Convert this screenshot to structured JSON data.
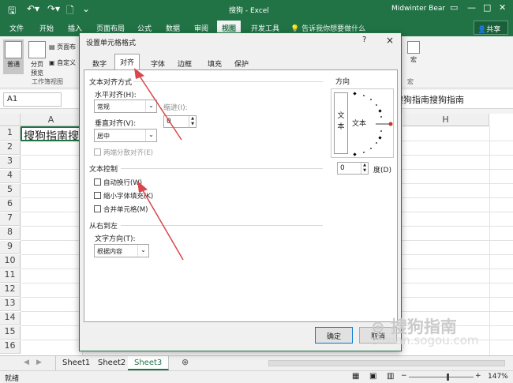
{
  "window": {
    "title": "搜狗 - Excel",
    "user": "Midwinter Bear"
  },
  "ribbon_tabs": [
    "文件",
    "开始",
    "插入",
    "页面布局",
    "公式",
    "数据",
    "审阅",
    "视图",
    "开发工具"
  ],
  "active_tab": "视图",
  "tell_me": "告诉我你想要做什么",
  "share": "共享",
  "ribbon": {
    "normal": "普通",
    "page_break_l1": "分页",
    "page_break_l2": "预览",
    "page_layout": "页面布",
    "custom_view": "自定义",
    "group_label": "工作簿视图",
    "macro": "宏",
    "macro_group": "宏"
  },
  "formula_bar": {
    "name_box": "A1",
    "content": "搜狗指南搜狗指南"
  },
  "grid": {
    "columns": [
      "A",
      "H"
    ],
    "rows": [
      "1",
      "2",
      "3",
      "4",
      "5",
      "6",
      "7",
      "8",
      "9",
      "10",
      "11",
      "12",
      "13",
      "14",
      "15",
      "16"
    ],
    "cell_a1": "搜狗指南搜"
  },
  "sheets": [
    "Sheet1",
    "Sheet2",
    "Sheet3"
  ],
  "active_sheet": "Sheet3",
  "status": {
    "mode": "就绪",
    "zoom": "147%"
  },
  "dialog": {
    "title": "设置单元格格式",
    "help": "?",
    "close": "×",
    "tabs": [
      "数字",
      "对齐",
      "字体",
      "边框",
      "填充",
      "保护"
    ],
    "active_tab": "对齐",
    "text_align_title": "文本对齐方式",
    "h_align_label": "水平对齐(H):",
    "h_align_value": "常规",
    "indent_label": "缩进(I):",
    "indent_value": "0",
    "v_align_label": "垂直对齐(V):",
    "v_align_value": "居中",
    "justify_distributed": "两端分散对齐(E)",
    "text_control_title": "文本控制",
    "wrap_text": "自动换行(W)",
    "shrink_to_fit": "缩小字体填充(K)",
    "merge_cells": "合并单元格(M)",
    "rtl_title": "从右到左",
    "text_direction_label": "文字方向(T):",
    "text_direction_value": "根据内容",
    "orientation_title": "方向",
    "vertical_text": "文本",
    "horizontal_text": "文本",
    "degree_value": "0",
    "degree_label": "度(D)",
    "ok": "确定",
    "cancel": "取消"
  },
  "watermark": {
    "line1": "搜狗指南",
    "line2": "zhinan.sogou.com"
  },
  "colors": {
    "excel_green": "#217346",
    "arrow": "#d9464b"
  }
}
